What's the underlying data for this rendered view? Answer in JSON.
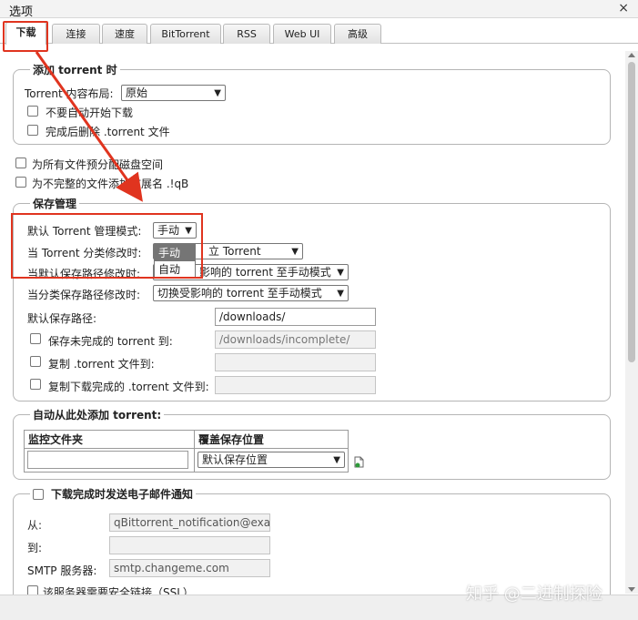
{
  "window": {
    "title": "选项",
    "close_glyph": "×"
  },
  "tabs": [
    {
      "label": "下载",
      "active": true
    },
    {
      "label": "连接"
    },
    {
      "label": "速度"
    },
    {
      "label": "BitTorrent"
    },
    {
      "label": "RSS"
    },
    {
      "label": "Web UI"
    },
    {
      "label": "高级"
    }
  ],
  "add_torrent": {
    "legend": "添加 torrent 时",
    "layout_label": "Torrent 内容布局:",
    "layout_value": "原始",
    "dont_start_label": "不要自动开始下载",
    "delete_after_label": "完成后删除 .torrent 文件"
  },
  "preallocate_label": "为所有文件预分配磁盘空间",
  "append_ext_label": "为不完整的文件添加扩展名 .!qB",
  "save_mgmt": {
    "legend": "保存管理",
    "default_mode_label": "默认 Torrent 管理模式:",
    "default_mode_value": "手动",
    "dropdown_options": [
      "手动",
      "自动"
    ],
    "category_changed_label": "当 Torrent 分类修改时:",
    "category_changed_value": "立 Torrent",
    "default_path_changed_label": "当默认保存路径修改时:",
    "default_path_changed_value": "影响的 torrent 至手动模式",
    "category_path_changed_label": "当分类保存路径修改时:",
    "category_path_changed_value": "切换受影响的 torrent 至手动模式",
    "default_save_path_label": "默认保存路径:",
    "default_save_path_value": "/downloads/",
    "incomplete_label": "保存未完成的 torrent 到:",
    "incomplete_value": "/downloads/incomplete/",
    "copy_torrent_label": "复制 .torrent 文件到:",
    "copy_finished_label": "复制下载完成的 .torrent 文件到:"
  },
  "auto_add": {
    "legend": "自动从此处添加 torrent:",
    "col_watch": "监控文件夹",
    "col_override": "覆盖保存位置",
    "override_value": "默认保存位置",
    "add_icon": "add-row-icon"
  },
  "email": {
    "legend": "下载完成时发送电子邮件通知",
    "from_label": "从:",
    "from_value": "qBittorrent_notification@exa",
    "to_label": "到:",
    "smtp_label": "SMTP 服务器:",
    "smtp_value": "smtp.changeme.com",
    "ssl_label": "该服务器需要安全链接（SSL）"
  },
  "watermark": "知乎 @二进制探险",
  "colors": {
    "highlight": "#e0341f",
    "dropdown_selected": "#757575"
  }
}
